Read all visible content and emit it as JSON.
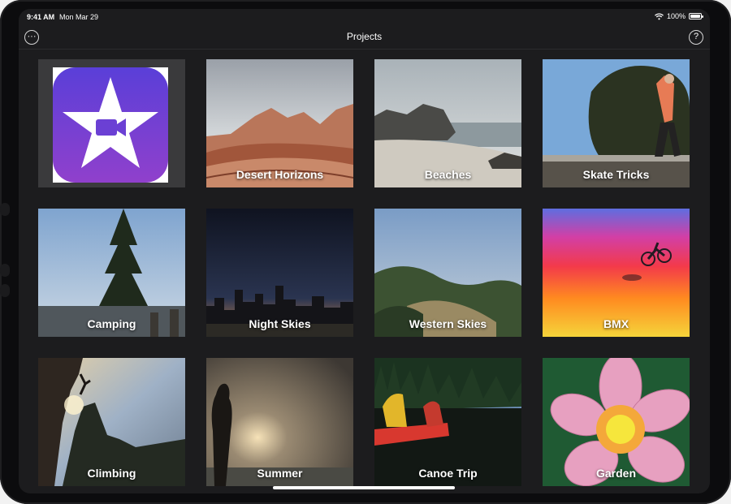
{
  "status": {
    "time": "9:41 AM",
    "date": "Mon Mar 29",
    "battery": "100%",
    "battery_level": 1.0
  },
  "nav": {
    "title": "Projects",
    "more_label": "···",
    "help_label": "?"
  },
  "projects": [
    {
      "label": "Desert Horizons"
    },
    {
      "label": "Beaches"
    },
    {
      "label": "Skate Tricks"
    },
    {
      "label": "Camping"
    },
    {
      "label": "Night Skies"
    },
    {
      "label": "Western Skies"
    },
    {
      "label": "BMX"
    },
    {
      "label": "Climbing"
    },
    {
      "label": "Summer"
    },
    {
      "label": "Canoe Trip"
    },
    {
      "label": "Garden"
    }
  ],
  "icons": {
    "app": "imovie-star-icon",
    "wifi": "wifi-icon",
    "battery": "battery-icon",
    "more": "more-icon",
    "help": "help-icon"
  },
  "colors": {
    "background": "#1c1c1e",
    "app_icon_top": "#5b3fd6",
    "app_icon_bottom": "#8e3fcf",
    "text": "#ffffff"
  }
}
